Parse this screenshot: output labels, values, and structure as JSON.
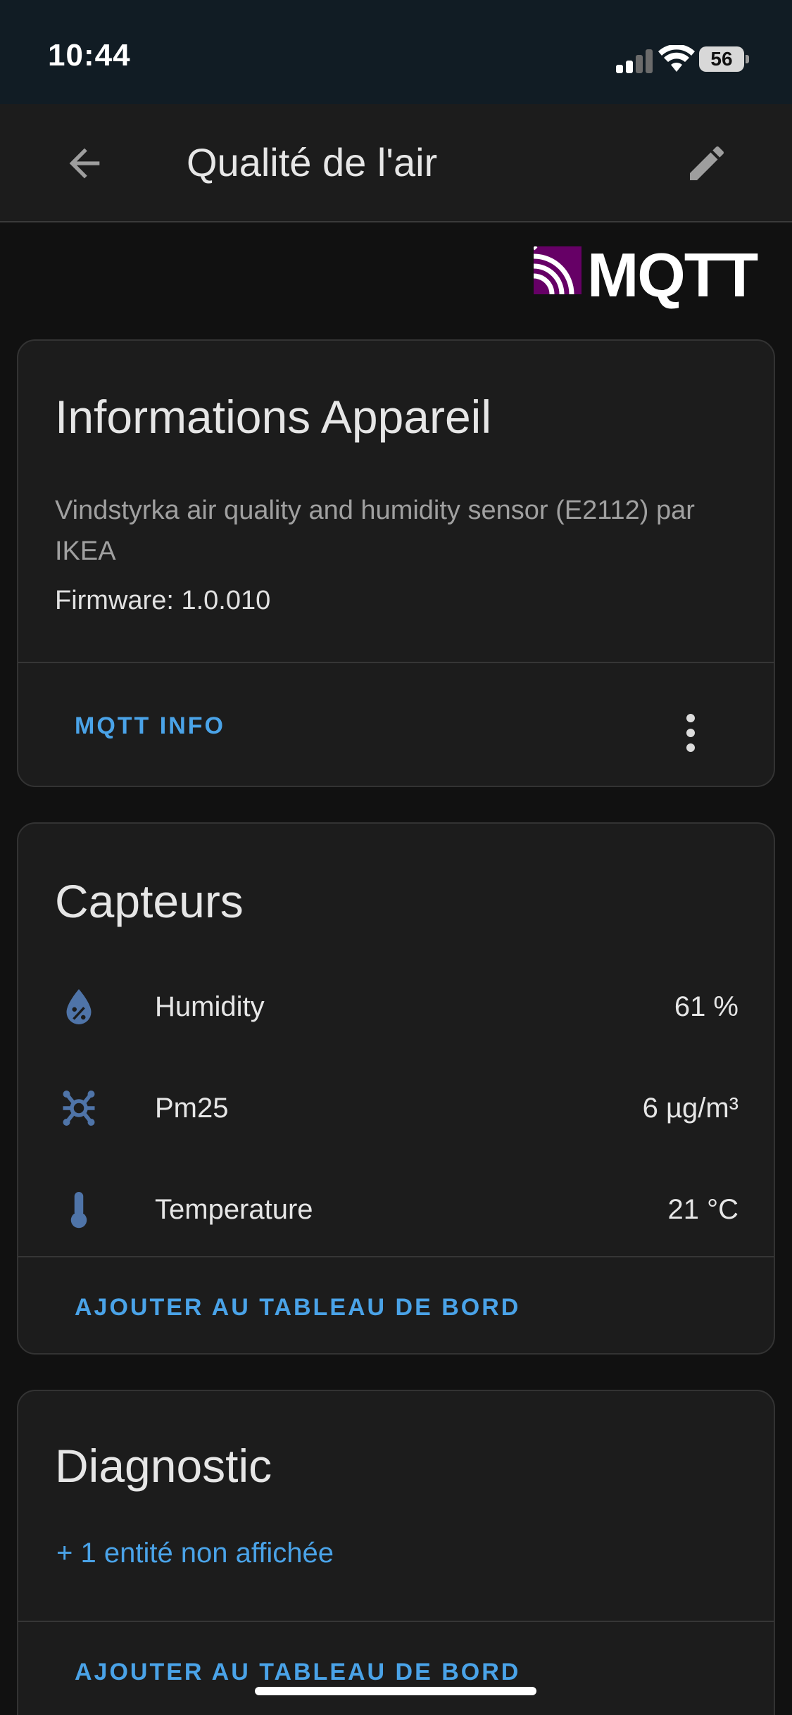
{
  "status_bar": {
    "time": "10:44",
    "battery": "56",
    "icons": [
      "signal-icon",
      "wifi-icon",
      "battery-icon"
    ]
  },
  "app_bar": {
    "title": "Qualité de l'air",
    "back_icon": "arrow-left-icon",
    "edit_icon": "pencil-icon"
  },
  "logo": {
    "text": "MQTT",
    "mark_color": "#660066"
  },
  "device_card": {
    "title": "Informations Appareil",
    "description": "Vindstyrka air quality and humidity sensor (E2112) par IKEA",
    "firmware": "Firmware: 1.0.010",
    "action": "MQTT INFO",
    "menu_icon": "more-vertical-icon"
  },
  "sensors_card": {
    "title": "Capteurs",
    "items": [
      {
        "name": "Humidity",
        "value": "61 %",
        "icon": "water-percent-icon"
      },
      {
        "name": "Pm25",
        "value": "6 µg/m³",
        "icon": "molecule-icon"
      },
      {
        "name": "Temperature",
        "value": "21 °C",
        "icon": "thermometer-icon"
      }
    ],
    "action": "AJOUTER AU TABLEAU DE BORD"
  },
  "diagnostic_card": {
    "title": "Diagnostic",
    "hidden_entities": "+ 1 entité non affichée",
    "action": "AJOUTER AU TABLEAU DE BORD"
  },
  "colors": {
    "accent": "#4aa3e8",
    "icon_blue": "#4f74a8",
    "card_bg": "#1c1c1c",
    "page_bg": "#111111"
  }
}
